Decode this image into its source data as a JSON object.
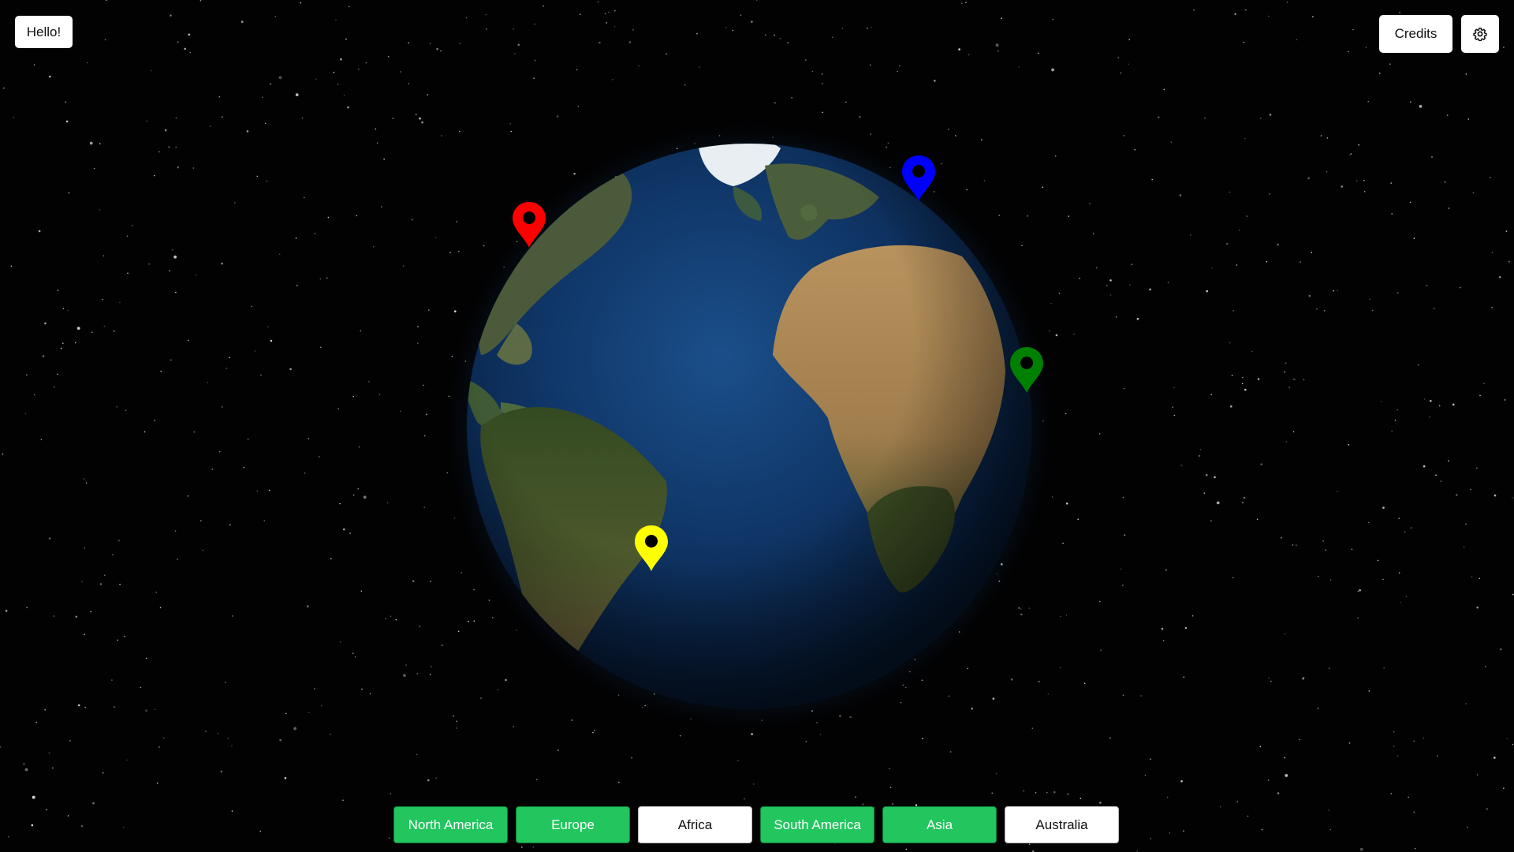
{
  "topbar": {
    "hello_label": "Hello!",
    "credits_label": "Credits",
    "settings_icon": "gear-icon"
  },
  "globe": {
    "markers": [
      {
        "name": "north-america-marker",
        "color": "#ff0000"
      },
      {
        "name": "europe-marker",
        "color": "#0000ff"
      },
      {
        "name": "asia-marker",
        "color": "#008000"
      },
      {
        "name": "south-america-marker",
        "color": "#ffff00"
      }
    ]
  },
  "continents": [
    {
      "label": "North America",
      "active": true
    },
    {
      "label": "Europe",
      "active": true
    },
    {
      "label": "Africa",
      "active": false
    },
    {
      "label": "South America",
      "active": true
    },
    {
      "label": "Asia",
      "active": true
    },
    {
      "label": "Australia",
      "active": false
    }
  ],
  "colors": {
    "active_button": "#22c55e",
    "inactive_button": "#ffffff",
    "background": "#000000"
  }
}
